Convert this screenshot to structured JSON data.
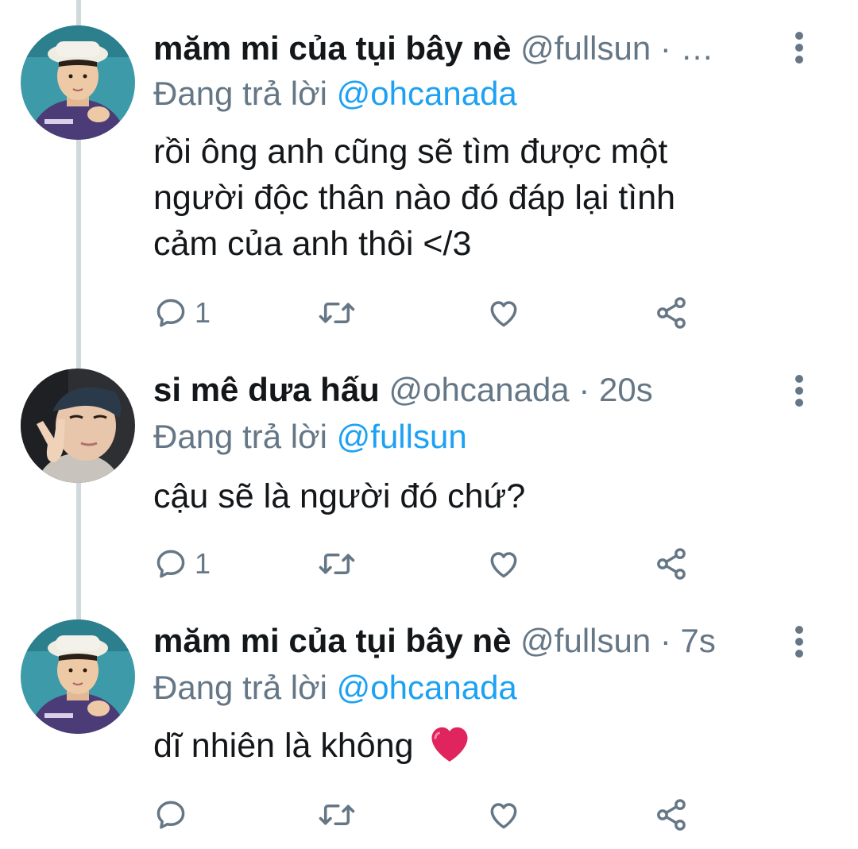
{
  "tweets": [
    {
      "display_name": "măm mi của tụi bây nè",
      "handle": "@fullsun",
      "time_sep": "· …",
      "reply_prefix": "Đang trả lời",
      "reply_to": "@ohcanada",
      "body_lines": [
        "rồi ông anh cũng sẽ tìm được một",
        "người độc thân nào đó đáp lại tình",
        "cảm của anh thôi </3"
      ],
      "reply_count": "1",
      "avatar_icon": "avatar-boy-bucket-hat"
    },
    {
      "display_name": "si mê dưa hấu",
      "handle": "@ohcanada",
      "time_sep": "· 20s",
      "reply_prefix": "Đang trả lời",
      "reply_to": "@fullsun",
      "body_lines": [
        "cậu sẽ là người đó chứ?"
      ],
      "reply_count": "1",
      "avatar_icon": "avatar-boy-peace-sign"
    },
    {
      "display_name": "măm mi của tụi bây nè",
      "handle": "@fullsun",
      "time_sep": "· 7s",
      "reply_prefix": "Đang trả lời",
      "reply_to": "@ohcanada",
      "body_lines": [
        "dĩ nhiên là không"
      ],
      "body_emoji": "red-heart-emoji",
      "reply_count": "",
      "avatar_icon": "avatar-boy-bucket-hat"
    }
  ],
  "icons": {
    "reply": "reply-icon",
    "retweet": "retweet-icon",
    "like": "heart-icon",
    "share": "share-icon",
    "more": "more-vertical-icon"
  },
  "colors": {
    "text": "#14171a",
    "muted": "#657786",
    "link": "#1da1f2",
    "thread_line": "#cfd9de",
    "heart": "#e0245e"
  }
}
